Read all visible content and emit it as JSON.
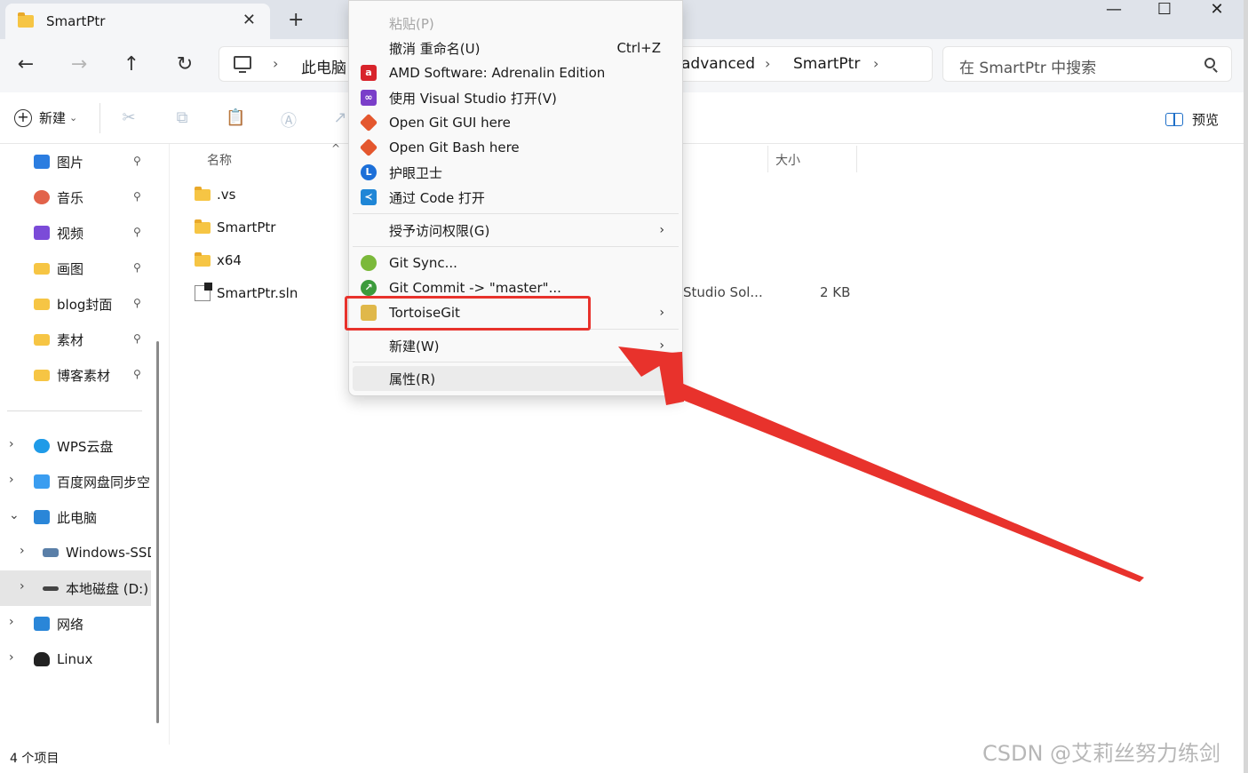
{
  "window": {
    "tab_title": "SmartPtr",
    "tab_close": "✕",
    "new_tab": "+",
    "minimize": "—",
    "maximize": "☐",
    "close": "✕"
  },
  "navigation": {
    "back": "←",
    "forward": "→",
    "up": "↑",
    "refresh": "↻"
  },
  "address_bar": {
    "crumbs": [
      "此电脑",
      "advanced",
      "SmartPtr"
    ],
    "separator": "›"
  },
  "search": {
    "placeholder": "在 SmartPtr 中搜索"
  },
  "command_bar": {
    "new_label": "新建",
    "new_dropdown": "⌄",
    "preview_label": "预览",
    "icons": [
      "cut-icon",
      "copy-icon",
      "paste-icon",
      "rename-icon",
      "share-icon"
    ]
  },
  "sidebar": {
    "quick_access": [
      {
        "label": "图片",
        "icon": "pictures-icon",
        "color": "#2b7de0"
      },
      {
        "label": "音乐",
        "icon": "music-icon",
        "color": "#e2634a"
      },
      {
        "label": "视频",
        "icon": "video-icon",
        "color": "#7b4bd8"
      },
      {
        "label": "画图",
        "icon": "folder-icon",
        "color": "#f6c544"
      },
      {
        "label": "blog封面",
        "icon": "folder-icon",
        "color": "#f6c544"
      },
      {
        "label": "素材",
        "icon": "folder-icon",
        "color": "#f6c544"
      },
      {
        "label": "博客素材",
        "icon": "folder-icon",
        "color": "#f6c544"
      }
    ],
    "pin_glyph": "📌",
    "tree": [
      {
        "label": "WPS云盘",
        "icon": "cloud-icon",
        "color": "#1f9be8",
        "expander": "›"
      },
      {
        "label": "百度网盘同步空",
        "icon": "baidu-netdisk-icon",
        "color": "#3a9df0",
        "expander": "›"
      },
      {
        "label": "此电脑",
        "icon": "computer-icon",
        "color": "#2a86d8",
        "expander": "⌄"
      },
      {
        "label": "Windows-SSD",
        "icon": "drive-icon",
        "color": "#5a7fa8",
        "expander": "›"
      },
      {
        "label": "本地磁盘 (D:)",
        "icon": "disk-icon",
        "color": "#444444",
        "expander": "›"
      },
      {
        "label": "网络",
        "icon": "network-icon",
        "color": "#2a86d8",
        "expander": "›"
      },
      {
        "label": "Linux",
        "icon": "linux-icon",
        "color": "#222222",
        "expander": "›"
      }
    ]
  },
  "file_list": {
    "columns": {
      "name": "名称",
      "size": "大小"
    },
    "sort_indicator": "^",
    "rows": [
      {
        "name": ".vs",
        "type_icon": "folder-icon"
      },
      {
        "name": "SmartPtr",
        "type_icon": "folder-icon"
      },
      {
        "name": "x64",
        "type_icon": "folder-icon"
      },
      {
        "name": "SmartPtr.sln",
        "type_icon": "sln-file-icon",
        "type_text": "Studio Sol...",
        "size": "2 KB"
      }
    ]
  },
  "context_menu": {
    "items": [
      {
        "label": "粘贴(P)",
        "disabled": true
      },
      {
        "label": "撤消 重命名(U)",
        "shortcut": "Ctrl+Z"
      },
      {
        "label": "AMD Software: Adrenalin Edition",
        "icon": "amd-icon",
        "color": "#d8242b"
      },
      {
        "label": "使用 Visual Studio 打开(V)",
        "icon": "visual-studio-icon",
        "color": "#7a3ec9"
      },
      {
        "label": "Open Git GUI here",
        "icon": "git-gui-icon",
        "color": "#e4572e"
      },
      {
        "label": "Open Git Bash here",
        "icon": "git-bash-icon",
        "color": "#e4572e"
      },
      {
        "label": "护眼卫士",
        "icon": "eye-guard-icon",
        "color": "#1c6fd8"
      },
      {
        "label": "通过 Code 打开",
        "icon": "vscode-icon",
        "color": "#1f86d6"
      },
      {
        "label": "授予访问权限(G)",
        "submenu": true
      },
      {
        "label": "Git Sync...",
        "icon": "git-sync-icon",
        "color": "#7bb93a"
      },
      {
        "label": "Git Commit -> \"master\"...",
        "icon": "git-commit-icon",
        "color": "#3c9b3c"
      },
      {
        "label": "TortoiseGit",
        "icon": "tortoisegit-icon",
        "color": "#e0b84a",
        "submenu": true
      },
      {
        "label": "新建(W)",
        "submenu": true
      },
      {
        "label": "属性(R)"
      }
    ],
    "submenu_arrow": "›"
  },
  "status_bar": {
    "item_count": "4 个项目"
  },
  "annotation": {
    "highlight_color": "#e8322c"
  },
  "watermark": "CSDN @艾莉丝努力练剑"
}
